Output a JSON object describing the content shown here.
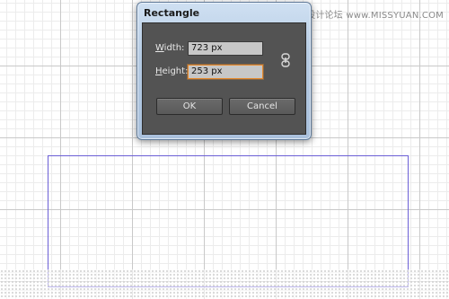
{
  "watermark": "思缘设计论坛 www.MISSYUAN.COM",
  "dialog": {
    "title": "Rectangle",
    "width": {
      "label_first": "W",
      "label_rest": "idth:",
      "value": "723 px"
    },
    "height": {
      "label_first": "H",
      "label_rest": "eight:",
      "value": "253 px"
    },
    "link_icon": "chain-link-icon",
    "ok_label": "OK",
    "cancel_label": "Cancel"
  },
  "colors": {
    "dialog_body": "#535353",
    "focus_border": "#e68a2e",
    "shape_stroke": "#6b5fd6"
  }
}
